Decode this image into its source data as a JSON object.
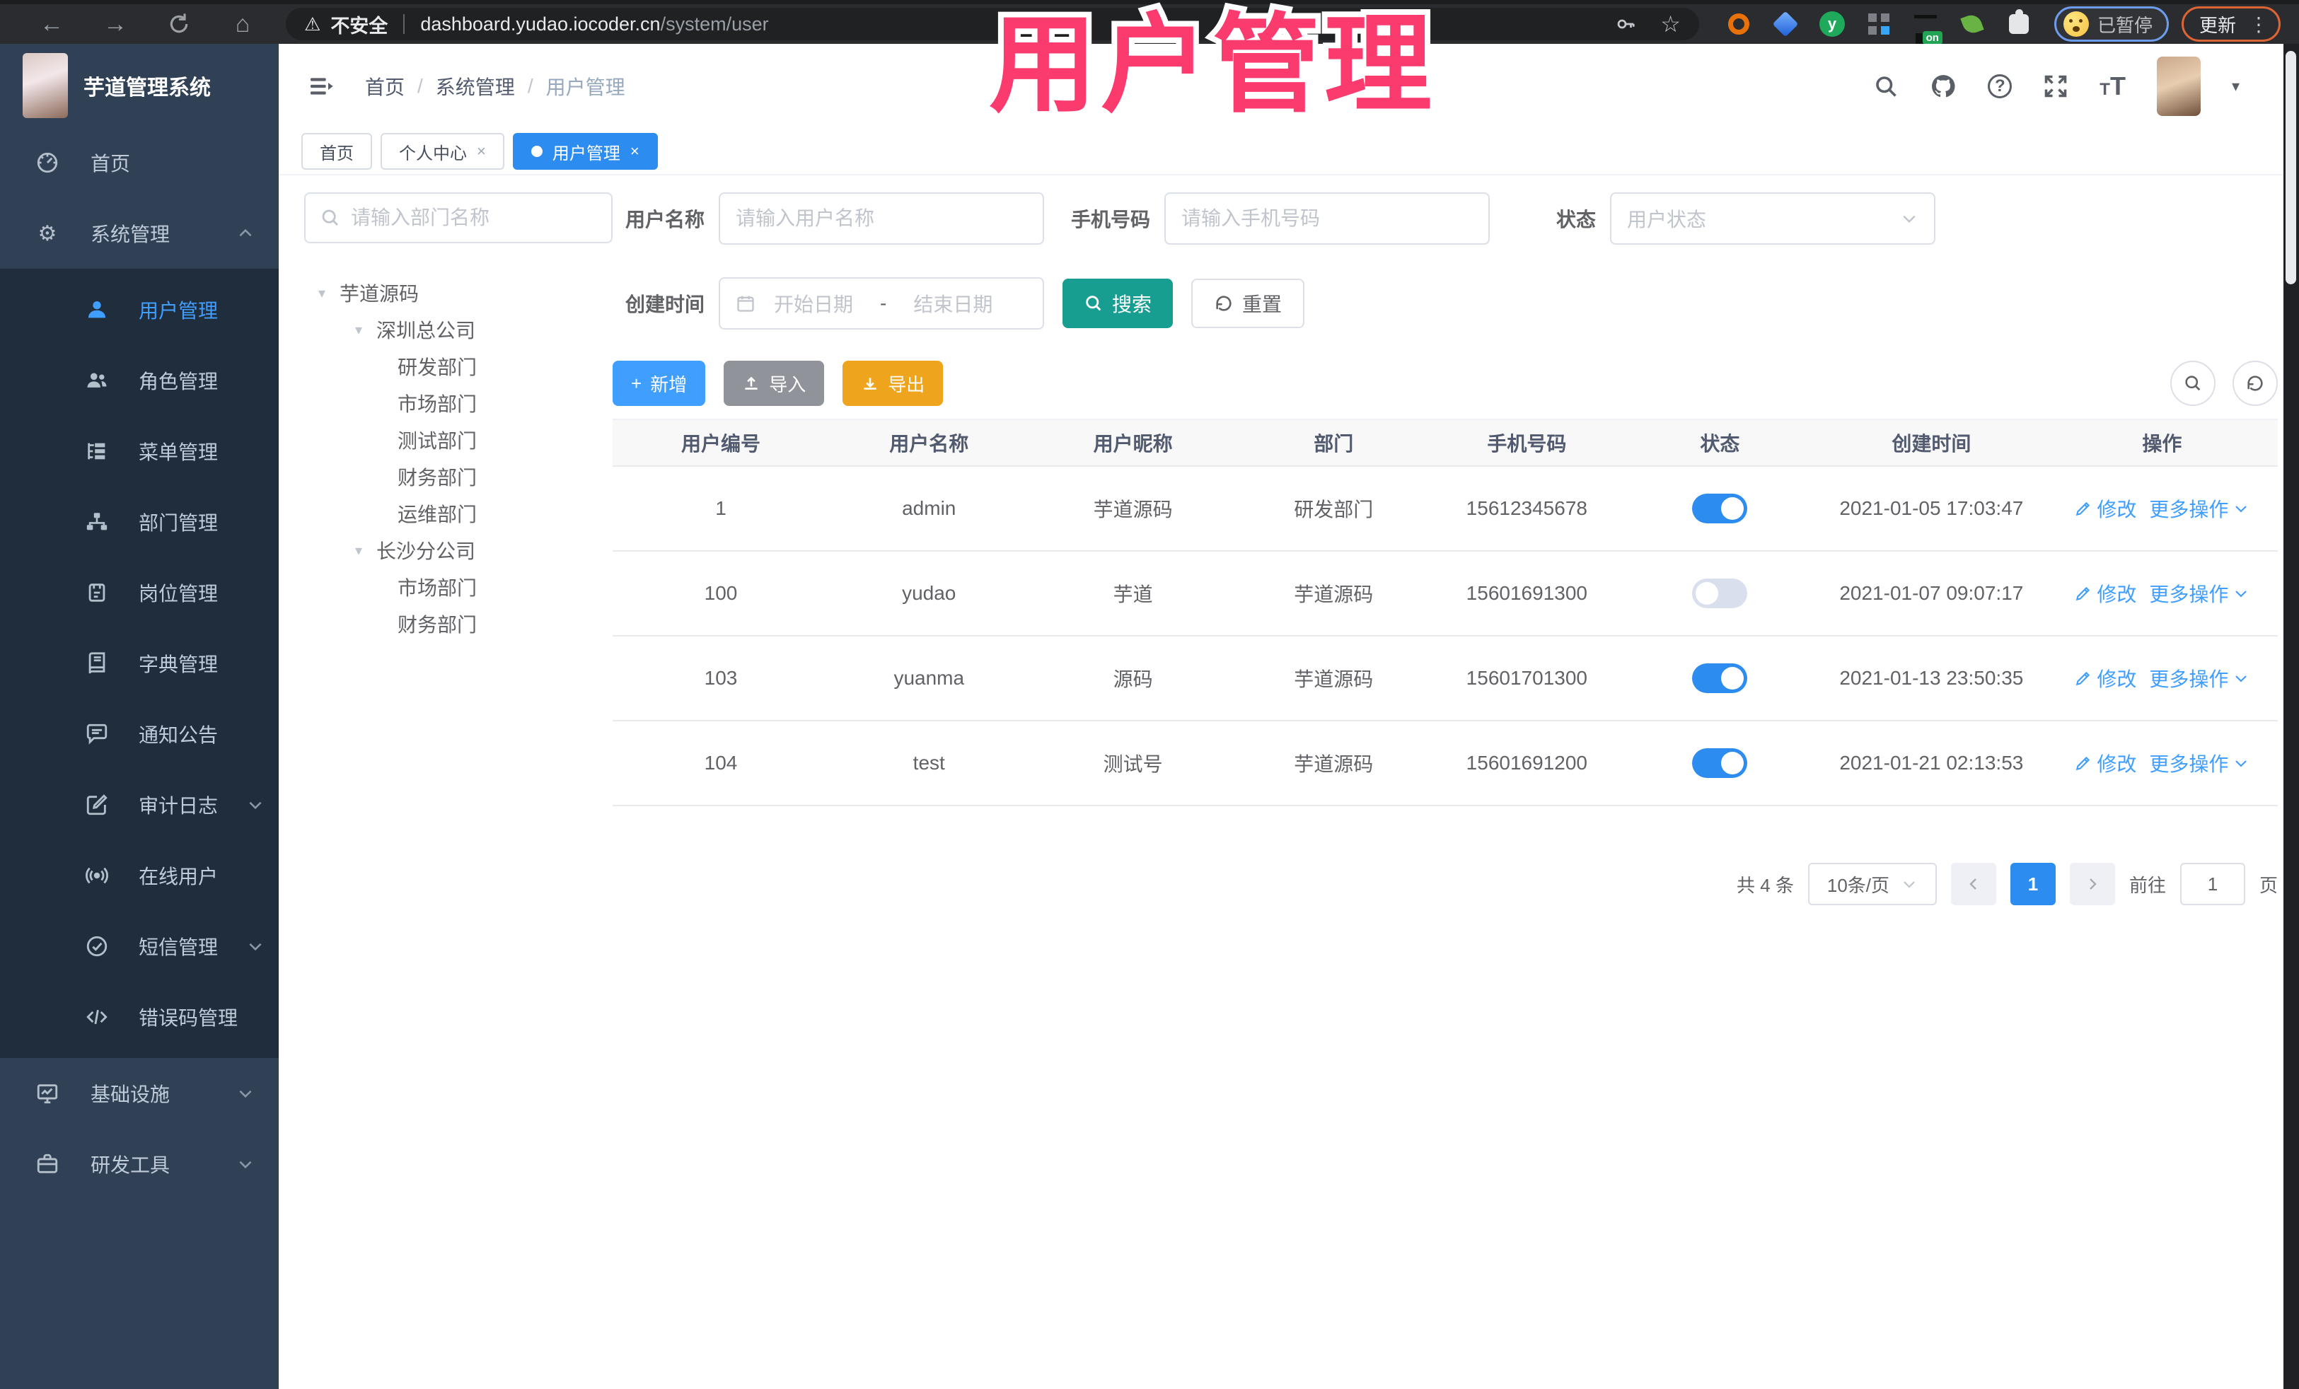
{
  "browser": {
    "security_label": "不安全",
    "url_host": "dashboard.yudao.iocoder.cn",
    "url_path": "/system/user",
    "paused_label": "已暂停",
    "update_label": "更新",
    "menu_dots": "⋮"
  },
  "overlay": {
    "title": "用户管理",
    "color": "#fb3a6e"
  },
  "app": {
    "title": "芋道管理系统"
  },
  "breadcrumb": {
    "items": [
      "首页",
      "系统管理",
      "用户管理"
    ],
    "separator": "/"
  },
  "tabs": [
    {
      "label": "首页",
      "closable": false,
      "active": false
    },
    {
      "label": "个人中心",
      "closable": true,
      "active": false
    },
    {
      "label": "用户管理",
      "closable": true,
      "active": true
    }
  ],
  "sidebar": {
    "items": {
      "home": {
        "label": "首页"
      },
      "system": {
        "label": "系统管理"
      },
      "infra": {
        "label": "基础设施"
      },
      "devtools": {
        "label": "研发工具"
      }
    },
    "system_children": {
      "user": {
        "label": "用户管理",
        "active": true
      },
      "role": {
        "label": "角色管理"
      },
      "menu": {
        "label": "菜单管理"
      },
      "dept": {
        "label": "部门管理"
      },
      "post": {
        "label": "岗位管理"
      },
      "dict": {
        "label": "字典管理"
      },
      "notice": {
        "label": "通知公告"
      },
      "audit": {
        "label": "审计日志"
      },
      "online": {
        "label": "在线用户"
      },
      "sms": {
        "label": "短信管理"
      },
      "errcode": {
        "label": "错误码管理"
      }
    }
  },
  "tree": {
    "search_placeholder": "请输入部门名称",
    "nodes": [
      {
        "label": "芋道源码",
        "level": 1
      },
      {
        "label": "深圳总公司",
        "level": 2
      },
      {
        "label": "研发部门",
        "level": 3
      },
      {
        "label": "市场部门",
        "level": 3
      },
      {
        "label": "测试部门",
        "level": 3
      },
      {
        "label": "财务部门",
        "level": 3
      },
      {
        "label": "运维部门",
        "level": 3
      },
      {
        "label": "长沙分公司",
        "level": 2
      },
      {
        "label": "市场部门",
        "level": 3
      },
      {
        "label": "财务部门",
        "level": 3
      }
    ]
  },
  "filters": {
    "username_label": "用户名称",
    "username_placeholder": "请输入用户名称",
    "mobile_label": "手机号码",
    "mobile_placeholder": "请输入手机号码",
    "status_label": "状态",
    "status_placeholder": "用户状态",
    "created_label": "创建时间",
    "date_start_placeholder": "开始日期",
    "date_separator": "-",
    "date_end_placeholder": "结束日期",
    "search_label": "搜索",
    "reset_label": "重置"
  },
  "toolbar": {
    "add_label": "新增",
    "import_label": "导入",
    "export_label": "导出"
  },
  "table": {
    "columns": [
      "用户编号",
      "用户名称",
      "用户昵称",
      "部门",
      "手机号码",
      "状态",
      "创建时间",
      "操作"
    ],
    "edit_label": "修改",
    "more_label": "更多操作",
    "rows": [
      {
        "id": "1",
        "username": "admin",
        "nickname": "芋道源码",
        "dept": "研发部门",
        "mobile": "15612345678",
        "status": true,
        "created": "2021-01-05 17:03:47"
      },
      {
        "id": "100",
        "username": "yudao",
        "nickname": "芋道",
        "dept": "芋道源码",
        "mobile": "15601691300",
        "status": false,
        "created": "2021-01-07 09:07:17"
      },
      {
        "id": "103",
        "username": "yuanma",
        "nickname": "源码",
        "dept": "芋道源码",
        "mobile": "15601701300",
        "status": true,
        "created": "2021-01-13 23:50:35"
      },
      {
        "id": "104",
        "username": "test",
        "nickname": "测试号",
        "dept": "芋道源码",
        "mobile": "15601691200",
        "status": true,
        "created": "2021-01-21 02:13:53"
      }
    ]
  },
  "pagination": {
    "total_text": "共 4 条",
    "page_size": "10条/页",
    "current_page": "1",
    "goto_label": "前往",
    "goto_value": "1",
    "page_unit": "页"
  }
}
